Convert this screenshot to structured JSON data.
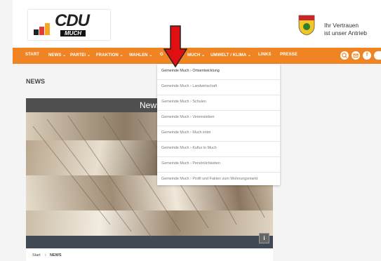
{
  "brand": {
    "logo_text": "CDU",
    "logo_sub": "MUCH",
    "slogan_line1": "Ihr Vertrauen",
    "slogan_line2": "ist unser Antrieb"
  },
  "nav": {
    "items": [
      "START",
      "NEWS ⌄",
      "PARTEI ⌄",
      "FRAKTION ⌄",
      "WAHLEN ⌄",
      "G",
      "MUCH ⌄",
      "UMWELT / KLIMA ⌄",
      "LINKS",
      "PRESSE"
    ],
    "icons": [
      "search-icon",
      "mail-icon",
      "facebook-icon"
    ]
  },
  "dropdown": {
    "items": [
      "Gemeinde Much › Ortsentwicklung",
      "Gemeinde Much › Landwirtschaft",
      "Gemeinde Much › Schulen",
      "Gemeinde Much › Vereinsleben",
      "Gemeinde Much › Much intim",
      "Gemeinde Much › Kultur in Much",
      "Gemeinde Much › Persönlichkeiten",
      "Gemeinde Much › Profil und Fakten zum Wohnungsmarkt"
    ]
  },
  "main": {
    "section_title": "NEWS",
    "hero_title": "News",
    "info_label": "i"
  },
  "breadcrumb": {
    "start": "Start",
    "sep": "›",
    "current": "NEWS"
  },
  "colors": {
    "accent": "#f08423",
    "arrow": "#e01010"
  }
}
